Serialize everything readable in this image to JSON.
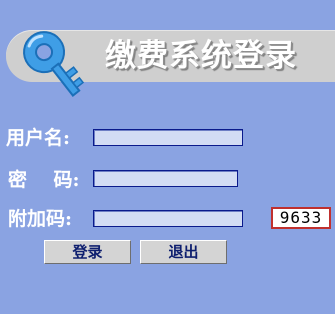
{
  "header": {
    "title": "缴费系统登录",
    "icon": "key-icon"
  },
  "form": {
    "username_label": "用户名:",
    "password_label": "密    码:",
    "captcha_label": "附加码:",
    "username_value": "",
    "password_value": "",
    "captcha_input_value": "",
    "captcha_code": "9633"
  },
  "buttons": {
    "login": "登录",
    "exit": "退出"
  },
  "colors": {
    "background": "#8aa3e2",
    "banner": "#cfcfcf",
    "field_border": "#0a1a8c",
    "captcha_border": "#c0302e",
    "button_text": "#0d1e6e",
    "key": "#3f9ee6"
  }
}
